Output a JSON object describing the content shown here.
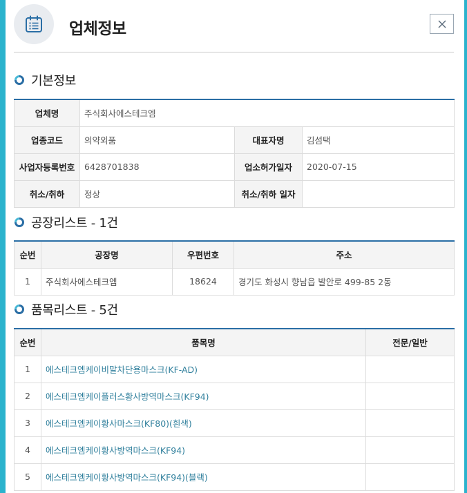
{
  "header": {
    "title": "업체정보"
  },
  "basic": {
    "title": "기본정보",
    "rows": [
      {
        "l1": "업체명",
        "v1": "주식회사에스테크엠"
      },
      {
        "l1": "업종코드",
        "v1": "의약외품",
        "l2": "대표자명",
        "v2": "김섬택"
      },
      {
        "l1": "사업자등록번호",
        "v1": "6428701838",
        "l2": "업소허가일자",
        "v2": "2020-07-15"
      },
      {
        "l1": "취소/취하",
        "v1": "정상",
        "l2": "취소/취하 일자",
        "v2": ""
      }
    ]
  },
  "factory": {
    "title": "공장리스트 - 1건",
    "columns": [
      "순번",
      "공장명",
      "우편번호",
      "주소"
    ],
    "rows": [
      [
        "1",
        "주식회사에스테크엠",
        "18624",
        "경기도 화성시 향남읍 발안로 499-85 2동"
      ]
    ]
  },
  "products": {
    "title": "품목리스트 - 5건",
    "columns": [
      "순번",
      "품목명",
      "전문/일반"
    ],
    "rows": [
      [
        "1",
        "에스테크엠케이비말차단용마스크(KF-AD)",
        ""
      ],
      [
        "2",
        "에스테크엠케이플러스황사방역마스크(KF94)",
        ""
      ],
      [
        "3",
        "에스테크엠케이황사마스크(KF80)(흰색)",
        ""
      ],
      [
        "4",
        "에스테크엠케이황사방역마스크(KF94)",
        ""
      ],
      [
        "5",
        "에스테크엠케이황사방역마스크(KF94)(블랙)",
        ""
      ]
    ]
  },
  "colors": {
    "accent": "#2a6ea5",
    "link": "#2f7f9c",
    "frame": "#2bb3cd"
  },
  "icons": {
    "header": "calendar-list-icon",
    "close": "close-icon",
    "section": "refresh-circle-icon"
  }
}
